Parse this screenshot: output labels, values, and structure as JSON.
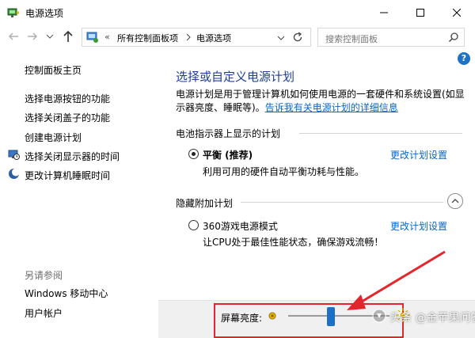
{
  "window": {
    "title": "电源选项"
  },
  "address_bar": {
    "separator": "«",
    "crumbs": [
      "所有控制面板项",
      "电源选项"
    ],
    "search_placeholder": "搜索控制面板"
  },
  "left_nav": {
    "home": "控制面板主页",
    "tasks": [
      "选择电源按钮的功能",
      "选择关闭盖子的功能",
      "创建电源计划",
      "选择关闭显示器的时间",
      "更改计算机睡眠时间"
    ],
    "see_also_title": "另请参阅",
    "see_also": [
      "Windows 移动中心",
      "用户帐户"
    ]
  },
  "main": {
    "title": "选择或自定义电源计划",
    "description": "电源计划是用于管理计算机如何使用电源的一套硬件和系统设置(如显示器亮度、睡眠等)。",
    "description_link": "告诉我有关电源计划的详细信息",
    "battery_section": "电池指示器上显示的计划",
    "hidden_section": "隐藏附加计划",
    "plans": [
      {
        "name": "平衡 (推荐)",
        "desc": "利用可用的硬件自动平衡功耗与性能。",
        "link": "更改计划设置",
        "selected": true
      },
      {
        "name": "360游戏电源模式",
        "desc": "让CPU处于最佳性能状态，确保游戏流畅！",
        "link": "更改计划设置",
        "selected": false
      }
    ]
  },
  "brightness": {
    "label": "屏幕亮度:",
    "level": 0.42
  },
  "watermark": "头条 @金苹果问答",
  "colors": {
    "link": "#0d65c3",
    "title": "#1e3f9a",
    "highlight": "#e2262b",
    "slider": "#1c6fc7"
  }
}
